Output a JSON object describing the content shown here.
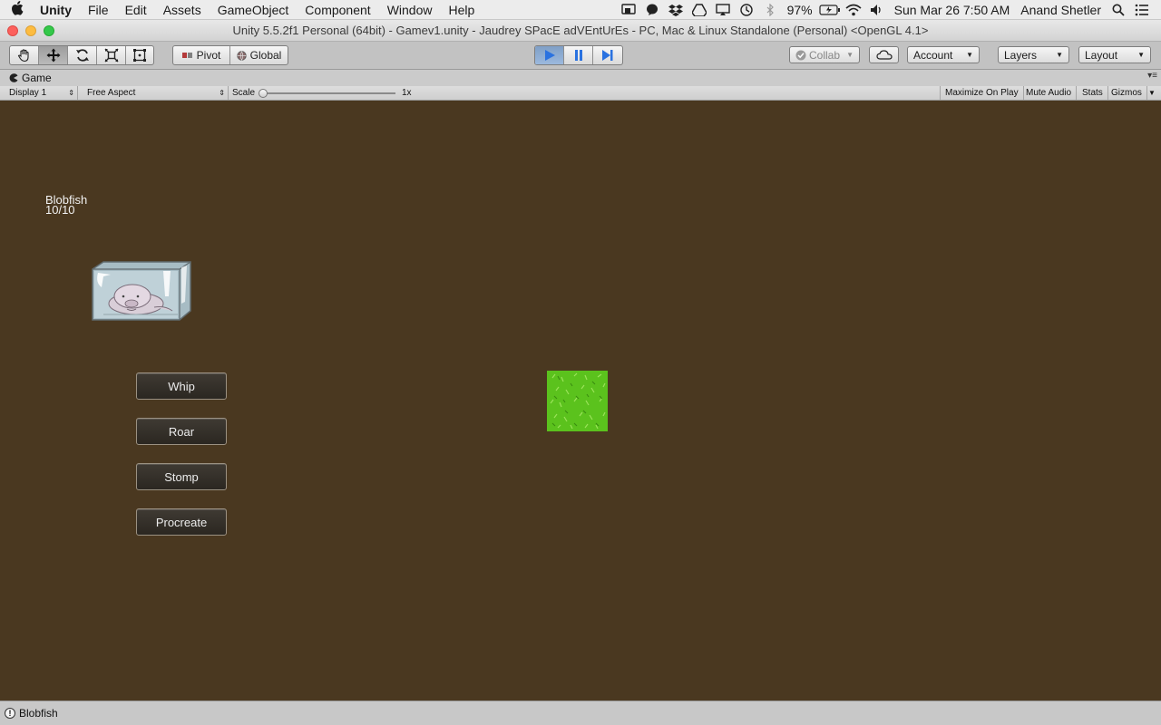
{
  "menubar": {
    "app_name": "Unity",
    "items": [
      "File",
      "Edit",
      "Assets",
      "GameObject",
      "Component",
      "Window",
      "Help"
    ],
    "battery": "97%",
    "clock": "Sun Mar 26  7:50 AM",
    "user": "Anand Shetler"
  },
  "window": {
    "title": "Unity 5.5.2f1 Personal (64bit) - Gamev1.unity - Jaudrey SPacE adVEntUrEs - PC, Mac & Linux Standalone (Personal) <OpenGL 4.1>"
  },
  "toolbar": {
    "pivot_label": "Pivot",
    "global_label": "Global",
    "collab_label": "Collab",
    "account_label": "Account",
    "layers_label": "Layers",
    "layout_label": "Layout"
  },
  "game_tab": {
    "title": "Game",
    "display": "Display 1",
    "aspect": "Free Aspect",
    "scale_label": "Scale",
    "scale_value": "1x",
    "maximize": "Maximize On Play",
    "mute": "Mute Audio",
    "stats": "Stats",
    "gizmos": "Gizmos"
  },
  "game": {
    "creature_name": "Blobfish",
    "creature_health": "10/10",
    "actions": [
      "Whip",
      "Roar",
      "Stomp",
      "Procreate"
    ]
  },
  "statusbar": {
    "message": "Blobfish"
  },
  "colors": {
    "game_background": "#4a3820",
    "grass": "#5bc21d",
    "play_active": "#2a72e0"
  }
}
